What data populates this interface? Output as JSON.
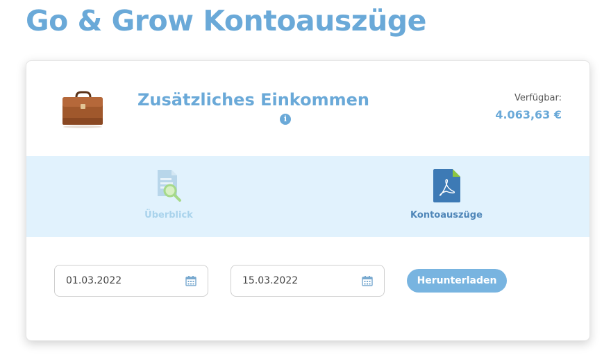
{
  "page": {
    "title": "Go & Grow Kontoauszüge"
  },
  "account": {
    "name": "Zusätzliches Einkommen",
    "info_icon": "info-icon",
    "available_label": "Verfügbar:",
    "available_amount": "4.063,63 €",
    "image": "briefcase-icon"
  },
  "tabs": [
    {
      "label": "Überblick",
      "icon": "document-search-icon",
      "active": false
    },
    {
      "label": "Kontoauszüge",
      "icon": "pdf-file-icon",
      "active": true
    }
  ],
  "filters": {
    "date_from": "01.03.2022",
    "date_to": "15.03.2022",
    "calendar_icon": "calendar-icon",
    "download_label": "Herunterladen"
  },
  "colors": {
    "accent": "#6aa9d8",
    "tab_background": "#e1f2fd",
    "button": "#78b4e0",
    "pdf_icon": "#3d7ab5",
    "pdf_corner": "#8dc63f"
  }
}
